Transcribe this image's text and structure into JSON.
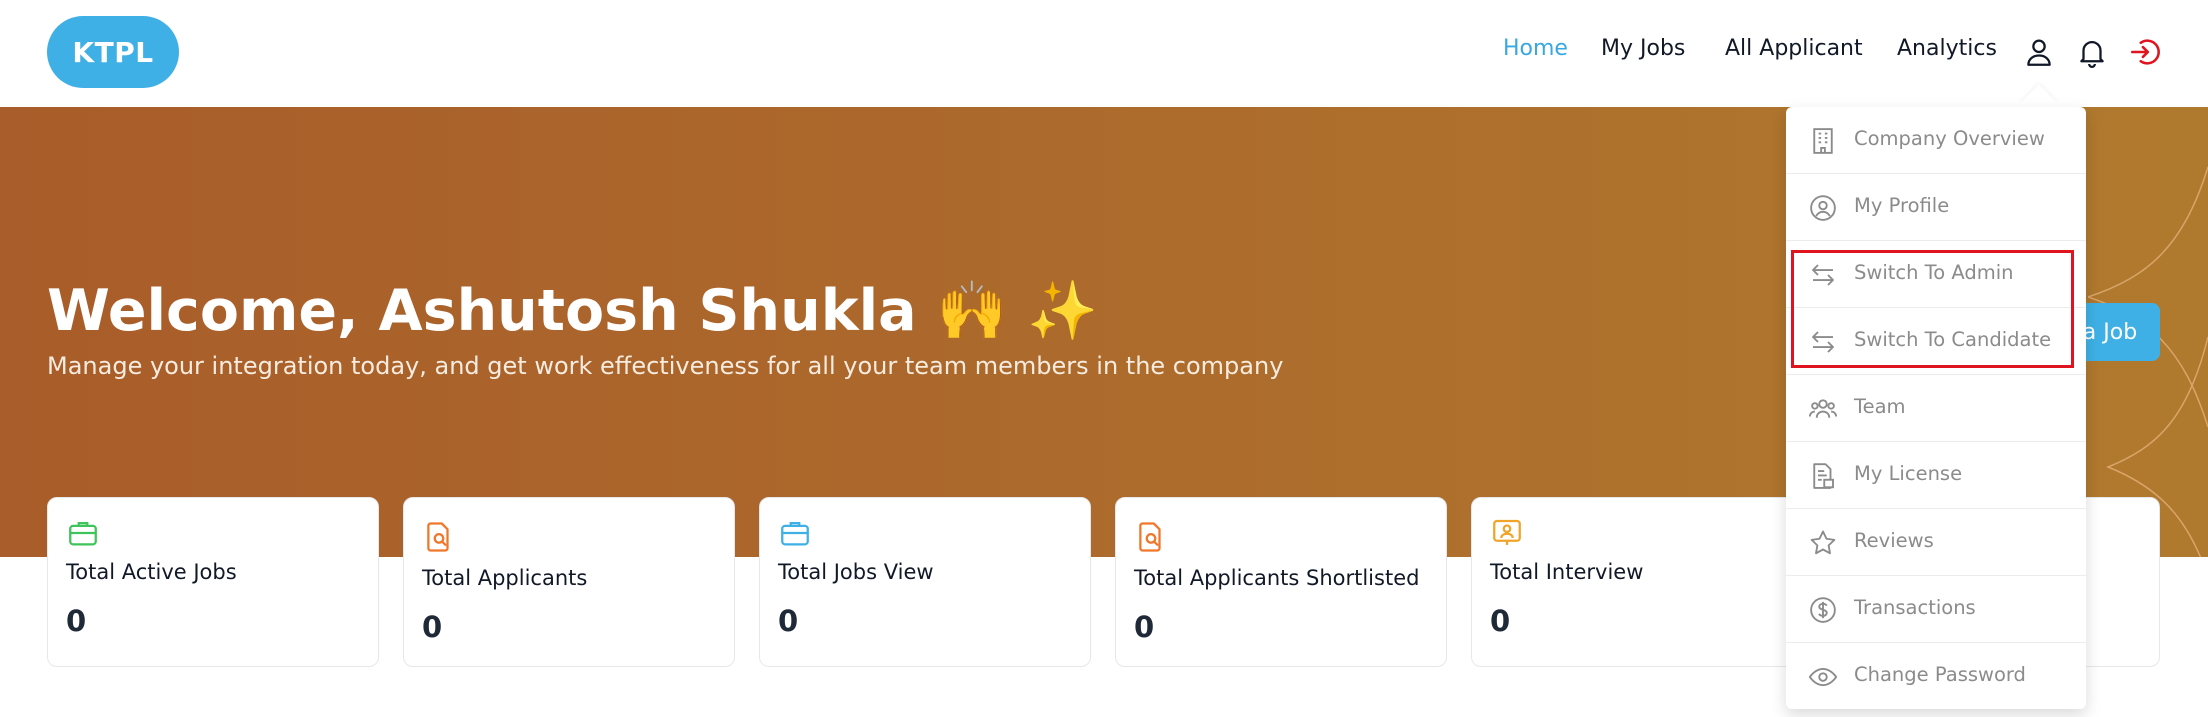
{
  "header": {
    "logo": "KTPL",
    "nav": [
      {
        "label": "Home",
        "active": true
      },
      {
        "label": "My Jobs",
        "active": false
      },
      {
        "label": "All Applicant",
        "active": false
      },
      {
        "label": "Analytics",
        "active": false
      }
    ],
    "icons": [
      "user-icon",
      "bell-icon",
      "logout-icon"
    ]
  },
  "hero": {
    "title": "Welcome, Ashutosh Shukla 🙌 ✨",
    "subtitle": "Manage your integration today, and get work effectiveness for all your team members in the company",
    "button_partial": "a Job"
  },
  "stats": [
    {
      "label": "Total Active Jobs",
      "value": "0",
      "icon": "briefcase-icon",
      "color": "#3ec45a"
    },
    {
      "label": "Total Applicants",
      "value": "0",
      "icon": "document-search-icon",
      "color": "#f0772a"
    },
    {
      "label": "Total Jobs View",
      "value": "0",
      "icon": "briefcase-icon",
      "color": "#3fb0e6"
    },
    {
      "label": "Total Applicants Shortlisted",
      "value": "0",
      "icon": "document-search-icon",
      "color": "#f0772a"
    },
    {
      "label": "Total Interview",
      "value": "0",
      "icon": "presentation-icon",
      "color": "#f0a52a"
    }
  ],
  "profile_menu": {
    "items": [
      {
        "label": "Company Overview",
        "icon": "building-icon"
      },
      {
        "label": "My Profile",
        "icon": "user-circle-icon"
      },
      {
        "label": "Switch To Admin",
        "icon": "switch-icon"
      },
      {
        "label": "Switch To Candidate",
        "icon": "switch-icon"
      },
      {
        "label": "Team",
        "icon": "team-icon"
      },
      {
        "label": "My License",
        "icon": "license-icon"
      },
      {
        "label": "Reviews",
        "icon": "star-icon"
      },
      {
        "label": "Transactions",
        "icon": "dollar-circle-icon"
      },
      {
        "label": "Change Password",
        "icon": "eye-icon"
      }
    ]
  },
  "colors": {
    "accent": "#3fb0e6",
    "hero_start": "#a95d2a",
    "hero_end": "#b07a2e",
    "highlight": "#e0141e",
    "logout": "#e0141e"
  }
}
